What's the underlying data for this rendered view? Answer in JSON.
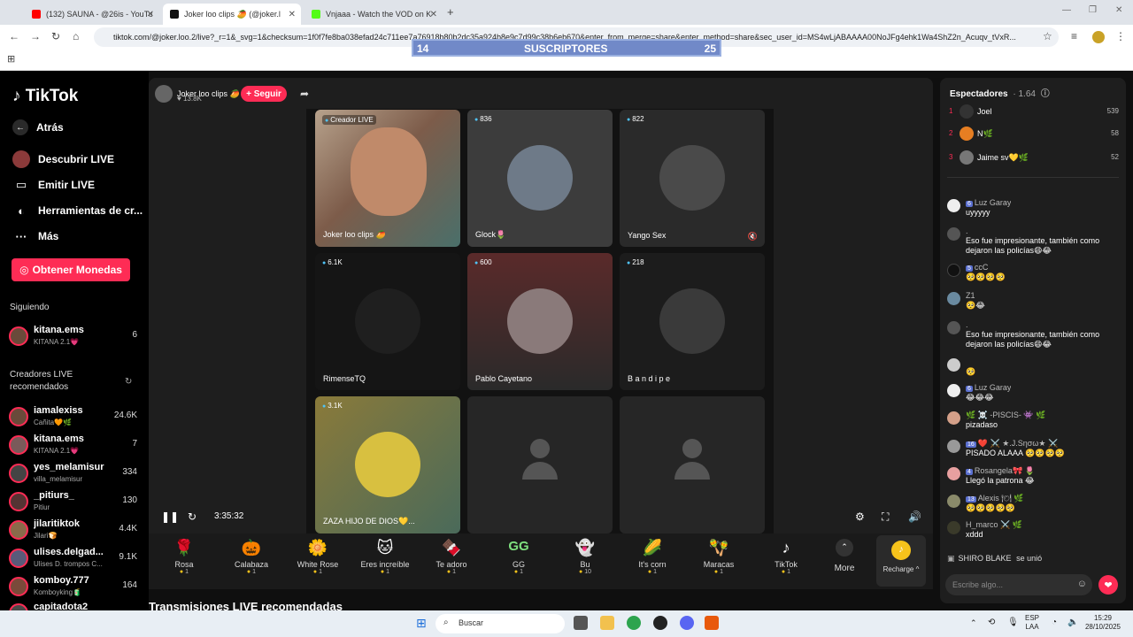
{
  "browser": {
    "tabs": [
      {
        "label": "(132) SAUNA - @26is - YouTube",
        "color": "#ff0000"
      },
      {
        "label": "Joker loo clips 🥭 (@joker.l",
        "color": "#111111"
      },
      {
        "label": "Vnjaaa - Watch the VOD on Kick",
        "color": "#53fc18"
      }
    ],
    "url": "tiktok.com/@joker.loo.2/live?_r=1&_svg=1&checksum=1f0f7fe8ba038efad24c711ee7a76918b80b2dc35a924b8e9c7d99c38b6eb670&enter_from_merge=share&enter_method=share&sec_user_id=MS4wLjABAAAA00NoJFg4ehk1Wa4ShZ2n_Acuqv_tVxR..."
  },
  "subscribers_overlay": {
    "left": "14",
    "label": "SUSCRIPTORES",
    "right": "25"
  },
  "sidebar": {
    "logo": "TikTok",
    "nav": [
      {
        "label": "Atrás",
        "icon": "back-arrow-icon",
        "glyph": "←"
      },
      {
        "label": "Descubrir LIVE",
        "icon": "live-discover-icon",
        "glyph": "◉"
      },
      {
        "label": "Emitir LIVE",
        "icon": "camera-icon",
        "glyph": "▭"
      },
      {
        "label": "Herramientas de cr...",
        "icon": "lightbulb-icon",
        "glyph": "◐"
      },
      {
        "label": "Más",
        "icon": "more-dots-icon",
        "glyph": "···"
      }
    ],
    "coins_button": "Obtener Monedas",
    "following_title": "Siguiendo",
    "following": [
      {
        "name": "kitana.ems",
        "sub": "KITANA 2.1💗",
        "count": "6"
      }
    ],
    "recommended_title": "Creadores LIVE recomendados",
    "recommended": [
      {
        "name": "iamalexiss",
        "sub": "Cañita🧡🌿",
        "count": "24.6K"
      },
      {
        "name": "kitana.ems",
        "sub": "KITANA 2.1💗",
        "count": "7"
      },
      {
        "name": "yes_melamisur",
        "sub": "villa_melamisur",
        "count": "334"
      },
      {
        "name": "_pitiurs_",
        "sub": "Pitiur",
        "count": "130"
      },
      {
        "name": "jilaritiktok",
        "sub": "Jilari🍞",
        "count": "4.4K"
      },
      {
        "name": "ulises.delgad...",
        "sub": "Ulises D. trompos C...",
        "count": "9.1K"
      },
      {
        "name": "komboy.777",
        "sub": "Komboyking🧃",
        "count": "164"
      },
      {
        "name": "capitadota2",
        "sub": "",
        "count": ""
      }
    ]
  },
  "host": {
    "name": "Joker loo clips 🥭",
    "likes": "♥ 13.8K",
    "follow": "+ Seguir"
  },
  "tiles": [
    {
      "count": "Creador LIVE",
      "name": "Joker loo clips 🥭",
      "host": true
    },
    {
      "count": "836",
      "name": "Glock🌷"
    },
    {
      "count": "822",
      "name": "Yango Sex",
      "muted": true
    },
    {
      "count": "6.1K",
      "name": "RimenseTQ"
    },
    {
      "count": "600",
      "name": "Pablo Cayetano"
    },
    {
      "count": "218",
      "name": "B a n d i p e"
    },
    {
      "count": "3.1K",
      "name": "ZAZA HIJO DE DIOS💛..."
    },
    {
      "count": "",
      "name": ""
    },
    {
      "count": "",
      "name": ""
    }
  ],
  "player": {
    "time": "3:35:32"
  },
  "gifts": [
    {
      "name": "Rosa",
      "price": "1",
      "glyph": "🌹"
    },
    {
      "name": "Calabaza",
      "price": "1",
      "glyph": "🎃"
    },
    {
      "name": "White Rose",
      "price": "1",
      "glyph": "🌼"
    },
    {
      "name": "Eres increíble",
      "price": "1",
      "glyph": "🐱"
    },
    {
      "name": "Te adoro",
      "price": "1",
      "glyph": "🍫"
    },
    {
      "name": "GG",
      "price": "1",
      "glyph": "GG"
    },
    {
      "name": "Bu",
      "price": "10",
      "glyph": "👻"
    },
    {
      "name": "It's corn",
      "price": "1",
      "glyph": "🌽"
    },
    {
      "name": "Maracas",
      "price": "1",
      "glyph": "🪇"
    },
    {
      "name": "TikTok",
      "price": "1",
      "glyph": "♪"
    }
  ],
  "more_label": "More",
  "recharge_label": "Recharge ^",
  "recommended_streams": "Transmisiones LIVE recomendadas",
  "viewers": {
    "title": "Espectadores",
    "count": "· 1.64",
    "top": [
      {
        "rank": "1",
        "name": "Joel",
        "score": "539",
        "color": "#333"
      },
      {
        "rank": "2",
        "name": "N🌿",
        "score": "58",
        "color": "#e67e22"
      },
      {
        "rank": "3",
        "name": "Jaime sv💛🌿",
        "score": "52",
        "color": "#777"
      }
    ]
  },
  "chat": [
    {
      "user": "Luz Garay",
      "level": "6",
      "msg": "uyyyyy"
    },
    {
      "user": ".",
      "level": "",
      "msg": "Eso fue impresionante, también como dejaron las policías😄😂"
    },
    {
      "user": "ccC",
      "level": "5",
      "msg": "🥺🥺🥺🥺"
    },
    {
      "user": "Z1",
      "level": "",
      "msg": "🥺😂"
    },
    {
      "user": ".",
      "level": "",
      "msg": "Eso fue impresionante, también como dejaron las policías😄😂"
    },
    {
      "user": "",
      "level": "",
      "msg": "🥺"
    },
    {
      "user": "Luz Garay",
      "level": "6",
      "msg": "😂😂😂"
    },
    {
      "user": "🌿 ☠️ -PISCIS- 👾 🌿",
      "level": "",
      "msg": "pizadaso"
    },
    {
      "user": "❤️ ⚔️ ★.J.Sησω★ ⚔️",
      "level": "16",
      "msg": "PISADO ALAAA 🥺🥺🥺🥺"
    },
    {
      "user": "Rosangela🎀 🌷",
      "level": "4",
      "msg": "Llegó la patrona 😂"
    },
    {
      "user": "Alexis 🍽 🌿",
      "level": "13",
      "msg": "🥺🥺🥺🥺🥺"
    },
    {
      "user": "H_marco ⚔️ 🌿",
      "level": "",
      "msg": "xddd"
    }
  ],
  "joined": {
    "user": "SHIRO BLAKE",
    "text": "se unió"
  },
  "chat_input": {
    "placeholder": "Escribe algo..."
  },
  "taskbar": {
    "search": "Buscar",
    "lang": "ESP",
    "lang2": "LAA",
    "time": "15:29",
    "date": "28/10/2025"
  }
}
